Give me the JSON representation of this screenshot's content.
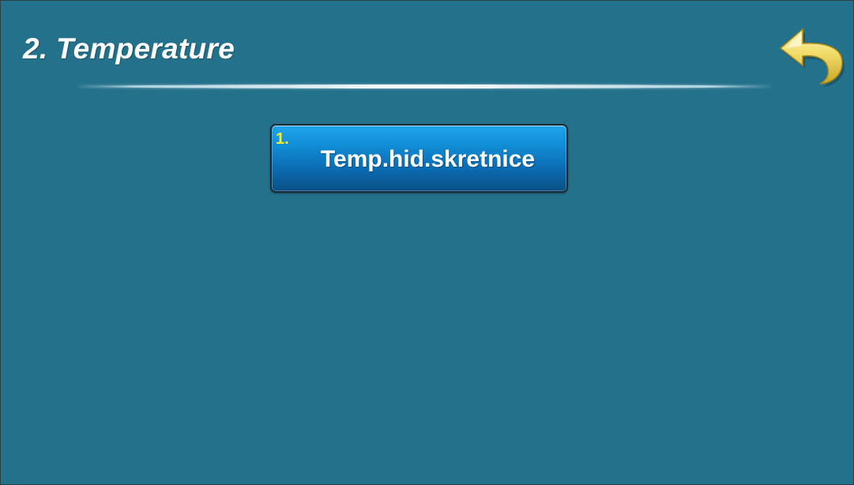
{
  "header": {
    "title": "2. Temperature",
    "back_icon": "back-arrow-icon"
  },
  "menu": {
    "items": [
      {
        "number": "1.",
        "label": "Temp.hid.skretnice"
      }
    ]
  },
  "colors": {
    "background": "#24718b",
    "button_top": "#1ea6ea",
    "button_bottom": "#0a4f85",
    "number_text": "#ffee22",
    "back_arrow": "#f3e27a"
  }
}
